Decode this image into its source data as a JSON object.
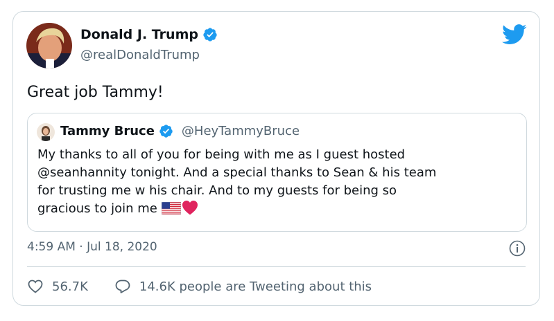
{
  "tweet": {
    "author_name": "Donald J. Trump",
    "author_handle": "@realDonaldTrump",
    "text": "Great job Tammy!",
    "timestamp": "4:59 AM · Jul 18, 2020",
    "likes": "56.7K",
    "retweets_label": "14.6K people are Tweeting about this"
  },
  "quote": {
    "author_name": "Tammy Bruce",
    "author_handle": "@HeyTammyBruce",
    "lines": [
      "My thanks to all of you for being with me as I guest hosted",
      "@seanhannity tonight. And a special thanks to Sean & his team",
      "for trusting me w his chair. And to my guests for being so",
      "gracious to join me"
    ],
    "emojis": [
      "us-flag-emoji",
      "red-heart-emoji"
    ]
  },
  "colors": {
    "brand_blue": "#1d9bf0",
    "text_primary": "#0f1419",
    "text_secondary": "#536471",
    "border": "#cfd9de",
    "heart_red": "#e0245e"
  },
  "icons": [
    "verified-icon",
    "twitter-bird-icon",
    "info-icon",
    "heart-icon",
    "reply-icon"
  ]
}
